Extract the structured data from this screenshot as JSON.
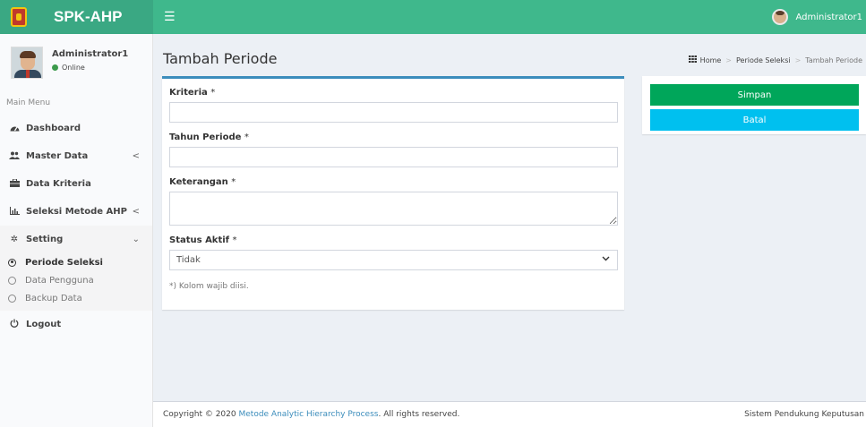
{
  "header": {
    "brand": "SPK-AHP",
    "menu_icon": "☰",
    "user_name": "Administrator1"
  },
  "sidebar": {
    "user_name": "Administrator1",
    "status": "Online",
    "menu_header": "Main Menu",
    "items": [
      {
        "label": "Dashboard",
        "icon": "dashboard-icon"
      },
      {
        "label": "Master Data",
        "icon": "users-icon"
      },
      {
        "label": "Data Kriteria",
        "icon": "briefcase-icon"
      },
      {
        "label": "Seleksi Metode AHP",
        "icon": "bar-chart-icon"
      },
      {
        "label": "Setting",
        "icon": "gear-icon"
      },
      {
        "label": "Logout",
        "icon": "power-icon"
      }
    ],
    "submenu": [
      {
        "label": "Periode Seleksi"
      },
      {
        "label": "Data Pengguna"
      },
      {
        "label": "Backup Data"
      }
    ]
  },
  "page": {
    "title": "Tambah Periode",
    "breadcrumb": [
      "Home",
      "Periode Seleksi",
      "Tambah Periode"
    ]
  },
  "form": {
    "kriteria_label": "Kriteria",
    "tahun_label": "Tahun Periode",
    "keterangan_label": "Keterangan",
    "status_label": "Status Aktif",
    "required_mark": "*",
    "status_value": "Tidak",
    "note": "*) Kolom wajib diisi."
  },
  "actions": {
    "save": "Simpan",
    "cancel": "Batal"
  },
  "footer": {
    "copyright_prefix": "Copyright © 2020",
    "link": "Metode Analytic Hierarchy Process",
    "suffix": ". All rights reserved.",
    "right": "Sistem Pendukung Keputusan"
  },
  "colors": {
    "header": "#3fb88c",
    "primary": "#3c8dbc",
    "success": "#00a65a",
    "info": "#00c0ef"
  }
}
